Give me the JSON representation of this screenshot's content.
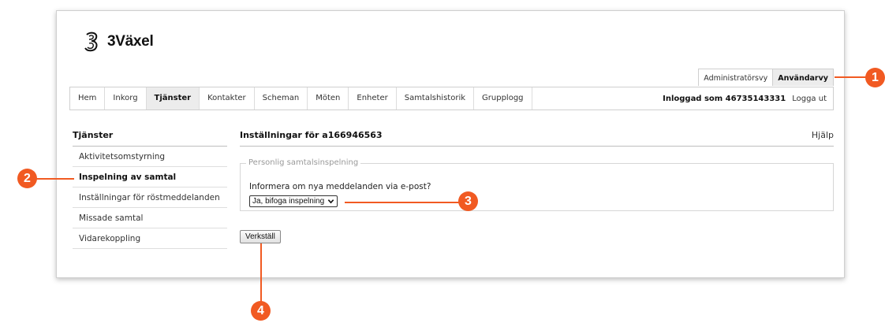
{
  "app": {
    "brand": "3Växel"
  },
  "view_tabs": [
    {
      "label": "Administratörsvy",
      "active": false
    },
    {
      "label": "Användarvy",
      "active": true
    }
  ],
  "nav": {
    "items": [
      {
        "label": "Hem"
      },
      {
        "label": "Inkorg"
      },
      {
        "label": "Tjänster",
        "active": true
      },
      {
        "label": "Kontakter"
      },
      {
        "label": "Scheman"
      },
      {
        "label": "Möten"
      },
      {
        "label": "Enheter"
      },
      {
        "label": "Samtalshistorik"
      },
      {
        "label": "Grupplogg"
      }
    ],
    "logged_in": "Inloggad som 46735143331",
    "logout": "Logga ut"
  },
  "sidebar": {
    "title": "Tjänster",
    "items": [
      {
        "label": "Aktivitetsomstyrning"
      },
      {
        "label": "Inspelning av samtal",
        "active": true
      },
      {
        "label": "Inställningar för röstmeddelanden"
      },
      {
        "label": "Missade samtal"
      },
      {
        "label": "Vidarekoppling"
      }
    ]
  },
  "main": {
    "title": "Inställningar för a166946563",
    "help": "Hjälp",
    "fieldset_legend": "Personlig samtalsinspelning",
    "question": "Informera om nya meddelanden via e-post?",
    "select_value": "Ja, bifoga inspelning",
    "apply_button": "Verkställ"
  },
  "callouts": [
    "1",
    "2",
    "3",
    "4"
  ],
  "colors": {
    "callout": "#f15a22",
    "active_tab_bg": "#ececec"
  }
}
